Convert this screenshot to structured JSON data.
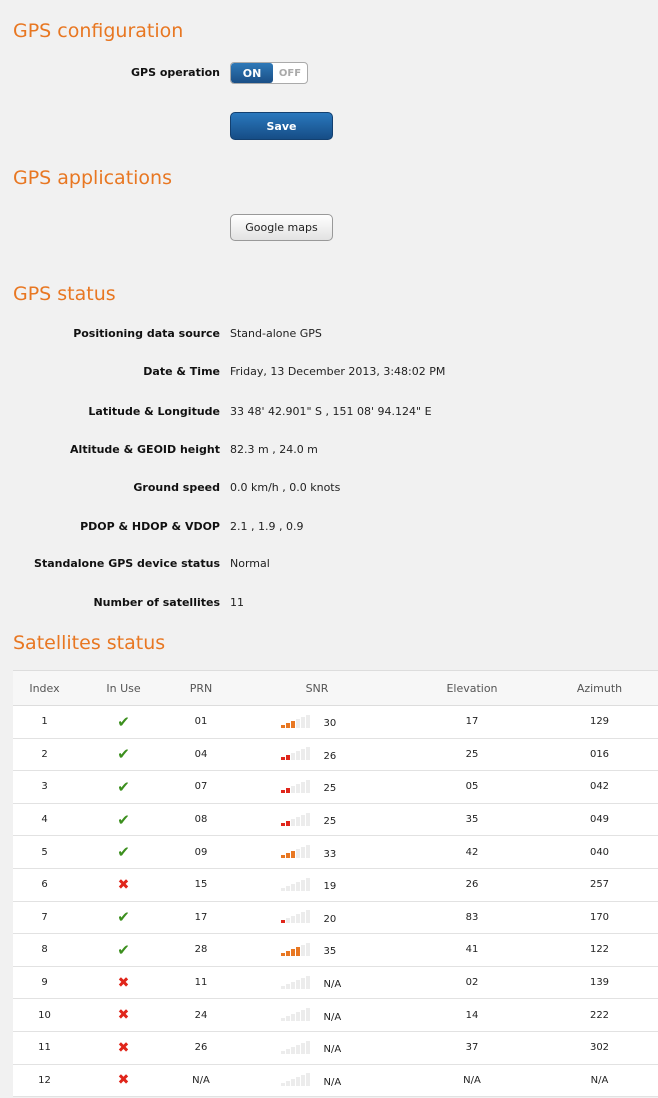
{
  "config": {
    "title": "GPS configuration",
    "operation_label": "GPS operation",
    "toggle_on": "ON",
    "toggle_off": "OFF",
    "save_label": "Save"
  },
  "applications": {
    "title": "GPS applications",
    "maps_label": "Google maps"
  },
  "status": {
    "title": "GPS status",
    "rows": [
      {
        "label": "Positioning data source",
        "value": "Stand-alone GPS"
      },
      {
        "label": "Date & Time",
        "value": "Friday, 13 December 2013, 3:48:02 PM"
      },
      {
        "label": "Latitude & Longitude",
        "value": "33 48' 42.901\" S ,  151 08' 94.124\" E"
      },
      {
        "label": "Altitude & GEOID height",
        "value": "82.3 m ,  24.0 m"
      },
      {
        "label": "Ground speed",
        "value": "0.0 km/h ,  0.0 knots"
      },
      {
        "label": "PDOP & HDOP & VDOP",
        "value": "2.1 ,   1.9 ,   0.9"
      },
      {
        "label": "Standalone GPS device status",
        "value": "Normal"
      },
      {
        "label": "Number of satellites",
        "value": "11"
      }
    ]
  },
  "satellites": {
    "title": "Satellites status",
    "headers": [
      "Index",
      "In Use",
      "PRN",
      "SNR",
      "Elevation",
      "Azimuth"
    ],
    "colors": {
      "low": "#e0261b",
      "mid": "#e87722",
      "empty": "#ececec",
      "check": "#3c8f1e",
      "cross": "#e0261b"
    },
    "rows": [
      {
        "index": "1",
        "in_use": true,
        "prn": "01",
        "snr": "30",
        "bars": 3,
        "elevation": "17",
        "azimuth": "129"
      },
      {
        "index": "2",
        "in_use": true,
        "prn": "04",
        "snr": "26",
        "bars": 2,
        "elevation": "25",
        "azimuth": "016"
      },
      {
        "index": "3",
        "in_use": true,
        "prn": "07",
        "snr": "25",
        "bars": 2,
        "elevation": "05",
        "azimuth": "042"
      },
      {
        "index": "4",
        "in_use": true,
        "prn": "08",
        "snr": "25",
        "bars": 2,
        "elevation": "35",
        "azimuth": "049"
      },
      {
        "index": "5",
        "in_use": true,
        "prn": "09",
        "snr": "33",
        "bars": 3,
        "elevation": "42",
        "azimuth": "040"
      },
      {
        "index": "6",
        "in_use": false,
        "prn": "15",
        "snr": "19",
        "bars": 0,
        "elevation": "26",
        "azimuth": "257"
      },
      {
        "index": "7",
        "in_use": true,
        "prn": "17",
        "snr": "20",
        "bars": 1,
        "elevation": "83",
        "azimuth": "170"
      },
      {
        "index": "8",
        "in_use": true,
        "prn": "28",
        "snr": "35",
        "bars": 4,
        "elevation": "41",
        "azimuth": "122"
      },
      {
        "index": "9",
        "in_use": false,
        "prn": "11",
        "snr": "N/A",
        "bars": 0,
        "elevation": "02",
        "azimuth": "139"
      },
      {
        "index": "10",
        "in_use": false,
        "prn": "24",
        "snr": "N/A",
        "bars": 0,
        "elevation": "14",
        "azimuth": "222"
      },
      {
        "index": "11",
        "in_use": false,
        "prn": "26",
        "snr": "N/A",
        "bars": 0,
        "elevation": "37",
        "azimuth": "302"
      },
      {
        "index": "12",
        "in_use": false,
        "prn": "N/A",
        "snr": "N/A",
        "bars": 0,
        "elevation": "N/A",
        "azimuth": "N/A"
      }
    ]
  }
}
